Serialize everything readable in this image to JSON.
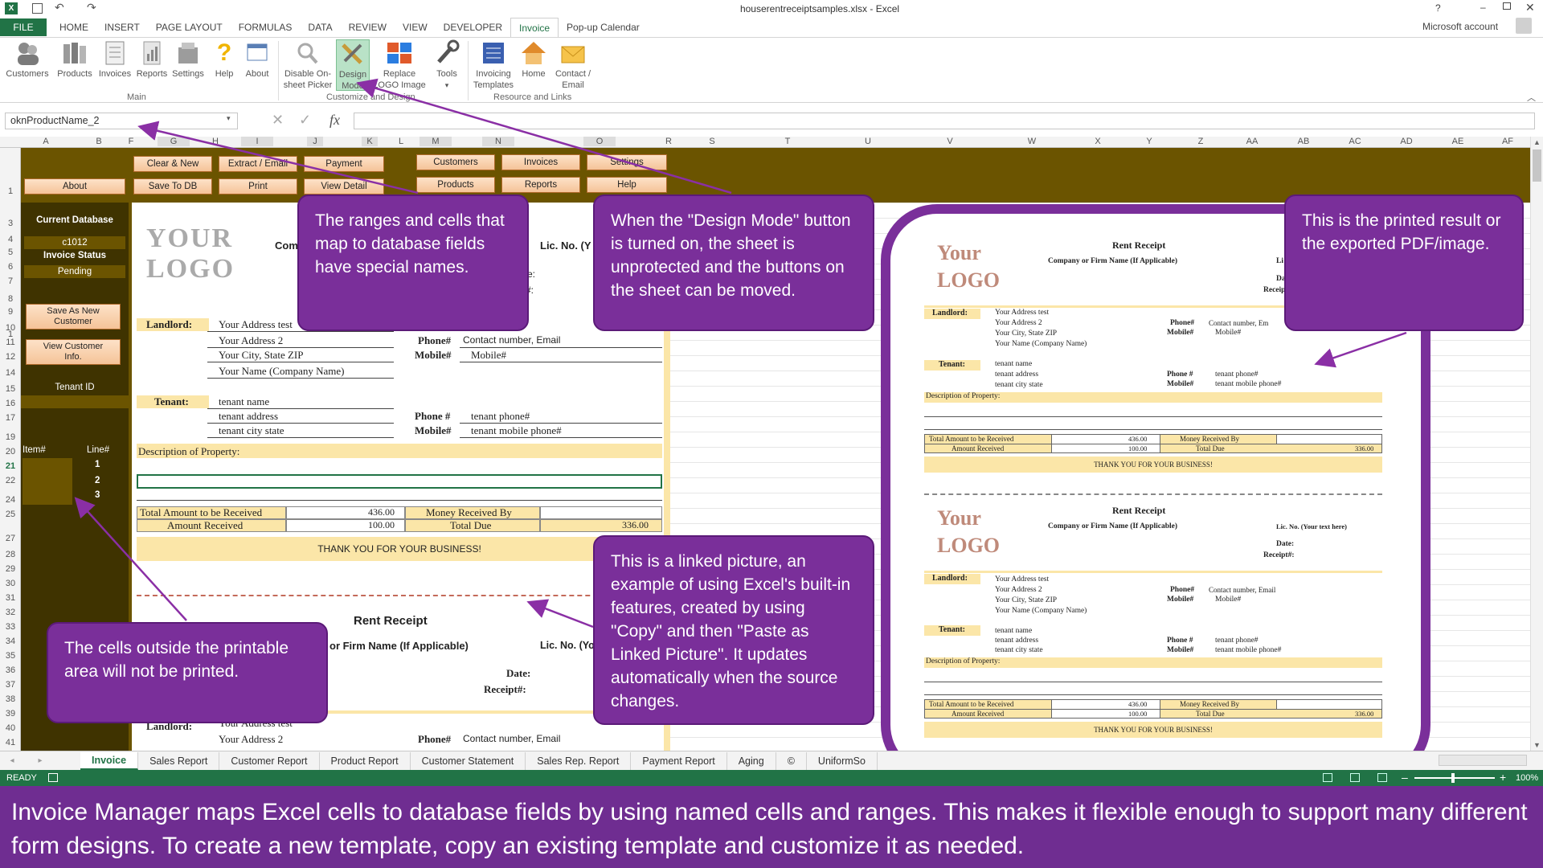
{
  "titlebar": {
    "file_name": "houserentreceiptsamples.xlsx - Excel",
    "help": "?",
    "account": "Microsoft account"
  },
  "ribbon_tabs": [
    "FILE",
    "HOME",
    "INSERT",
    "PAGE LAYOUT",
    "FORMULAS",
    "DATA",
    "REVIEW",
    "VIEW",
    "DEVELOPER",
    "Invoice",
    "Pop-up Calendar"
  ],
  "ribbon": {
    "group_main": "Main",
    "group_customize": "Customize and Design",
    "group_resource": "Resource and Links",
    "customers": "Customers",
    "products": "Products",
    "invoices": "Invoices",
    "reports": "Reports",
    "settings": "Settings",
    "help": "Help",
    "about": "About",
    "disable_picker_1": "Disable On-",
    "disable_picker_2": "sheet Picker",
    "design_1": "Design",
    "design_2": "Mode",
    "replace_1": "Replace",
    "replace_2": "LOGO Image",
    "tools": "Tools",
    "templates_1": "Invoicing",
    "templates_2": "Templates",
    "home": "Home",
    "contact_1": "Contact /",
    "contact_2": "Email"
  },
  "formula_bar": {
    "name_box": "oknProductName_2",
    "fx": "fx",
    "formula": ""
  },
  "columns": [
    "A",
    "B",
    "F",
    "G",
    "H",
    "I",
    "J",
    "K",
    "L",
    "M",
    "N",
    "O",
    "R",
    "S",
    "T",
    "U",
    "V",
    "W",
    "X",
    "Y",
    "Z",
    "AA",
    "AB",
    "AC",
    "AD",
    "AE",
    "AF"
  ],
  "rows": [
    "1",
    "3",
    "4",
    "5",
    "6",
    "7",
    "8",
    "9",
    "10",
    "11",
    "12",
    "14",
    "15",
    "16",
    "17",
    "19",
    "20",
    "21",
    "22",
    "24",
    "25",
    "27",
    "28",
    "29",
    "30",
    "31",
    "32",
    "33",
    "34",
    "35",
    "36",
    "37",
    "38",
    "39",
    "40",
    "41"
  ],
  "sheet_buttons": {
    "about": "About",
    "clear_new": "Clear & New",
    "extract_email": "Extract / Email",
    "payment": "Payment",
    "save_db": "Save To DB",
    "print": "Print",
    "view_detail": "View Detail",
    "customers": "Customers",
    "invoices": "Invoices",
    "settings": "Settings",
    "products": "Products",
    "reports": "Reports",
    "help": "Help"
  },
  "left_panel": {
    "current_db": "Current Database",
    "db_value": "c1012",
    "invoice_status": "Invoice Status",
    "status_value": "Pending",
    "save_new_1": "Save As New",
    "save_new_2": "Customer",
    "view_info_1": "View Customer",
    "view_info_2": "Info.",
    "tenant_id": "Tenant ID",
    "item": "Item#",
    "line": "Line#",
    "lines": [
      "1",
      "2",
      "3"
    ]
  },
  "receipt": {
    "logo_1": "YOUR",
    "logo_2": "LOGO",
    "company_partial": "Com",
    "lic_partial": "Lic. No. (Y",
    "e_colon": "e:",
    "hash_colon": "#:",
    "landlord": "Landlord:",
    "addr_test": "Your Address test",
    "addr_2": "Your Address 2",
    "city": "Your City, State ZIP",
    "name": "Your Name (Company Name)",
    "phone_label": "Phone#",
    "phone_value": "Contact number, Email",
    "mobile_label": "Mobile#",
    "mobile_value": "Mobile#",
    "tenant": "Tenant:",
    "tenant_name": "tenant name",
    "tenant_addr": "tenant address",
    "tenant_city": "tenant city state",
    "tphone_label": "Phone #",
    "tphone_value": "tenant phone#",
    "tmobile_label": "Mobile#",
    "tmobile_value": "tenant mobile phone#",
    "desc": "Description of Property:",
    "total_label": "Total Amount to be Received",
    "total_value": "436.00",
    "received_label": "Amount Received",
    "received_value": "100.00",
    "money_by": "Money Received By",
    "total_due": "Total Due",
    "due_value": "336.00",
    "thanks": "THANK YOU FOR YOUR BUSINESS!",
    "rent_receipt": "Rent Receipt",
    "firm_partial": "or Firm Name (If Applicable)",
    "lic_partial_2": "Lic. No. (Yo",
    "date": "Date:",
    "receipt_no": "Receipt#:",
    "addr_test_partial": "Your Address test"
  },
  "printed": {
    "logo_1": "Your",
    "logo_2": "LOGO",
    "title": "Rent Receipt",
    "company": "Company or Firm Name (If Applicable)",
    "lic": "Lic. No. (Your text here)",
    "lic_partial": "Li",
    "date": "Date:",
    "receipt": "Receipt#:",
    "landlord": "Landlord:",
    "addr_test": "Your Address test",
    "addr_2": "Your Address 2",
    "city": "Your City, State ZIP",
    "name": "Your Name (Company Name)",
    "phone_label": "Phone#",
    "phone_value": "Contact number, Email",
    "mobile_label": "Mobile#",
    "mobile_value": "Mobile#",
    "phone_partial": "Contact number, Em",
    "tenant": "Tenant:",
    "tenant_name": "tenant name",
    "tenant_addr": "tenant address",
    "tenant_city": "tenant city state",
    "tphone_label": "Phone #",
    "tphone_value": "tenant phone#",
    "tmobile_label": "Mobile#",
    "tmobile_value": "tenant mobile phone#",
    "desc": "Description of Property:",
    "total_label": "Total Amount to be Received",
    "total_value": "436.00",
    "received_label": "Amount Received",
    "received_value": "100.00",
    "money_by": "Money Received By",
    "total_due": "Total Due",
    "due_value": "336.00",
    "thanks": "THANK YOU FOR YOUR BUSINESS!"
  },
  "callouts": {
    "ranges": "The ranges and cells that map to database fields have special names.",
    "design": "When the \"Design Mode\" button is turned on, the sheet is unprotected and the buttons on the sheet can be moved.",
    "printed": "This is the printed result or the exported PDF/image.",
    "outside": "The cells outside the printable area will not be printed.",
    "linked": "This is a linked picture, an example of using Excel's built-in features, created by using \"Copy\" and then \"Paste as Linked Picture\". It updates automatically when the source changes."
  },
  "sheet_tabs": [
    "Invoice",
    "Sales Report",
    "Customer Report",
    "Product Report",
    "Customer Statement",
    "Sales Rep. Report",
    "Payment Report",
    "Aging",
    "©",
    "UniformSo"
  ],
  "status": {
    "ready": "READY",
    "zoom": "100%"
  },
  "caption": "Invoice Manager maps Excel cells to database fields by using named cells and ranges. This makes it flexible enough to support many different form designs. To create a new template, copy an existing template and customize it as needed.",
  "colors": {
    "excel_green": "#217346",
    "sheet_dark": "#3f3300",
    "olive": "#6b5400",
    "purple": "#7a2f9a",
    "caption_bg": "#6f2d91",
    "highlight": "#fbe6a8"
  }
}
